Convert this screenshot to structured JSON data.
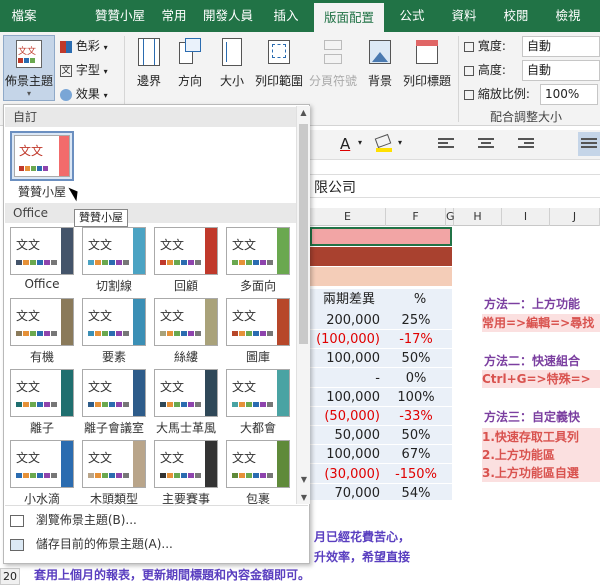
{
  "tabs": [
    "檔案",
    "贊贊小屋",
    "常用",
    "開發人員",
    "插入",
    "版面配置",
    "公式",
    "資料",
    "校閱",
    "檢視"
  ],
  "active_tab": "版面配置",
  "ribbon": {
    "theme_button": "佈景主題",
    "colors": "色彩",
    "fonts": "字型",
    "effects": "效果",
    "margins": "邊界",
    "orientation": "方向",
    "size": "大小",
    "print_area": "列印範圍",
    "breaks": "分頁符號",
    "background": "背景",
    "print_titles": "列印標題",
    "width_label": "寬度:",
    "width_value": "自動",
    "height_label": "高度:",
    "height_value": "自動",
    "scale_label": "縮放比例:",
    "scale_value": "100%",
    "group_label": "配合調整大小"
  },
  "gallery": {
    "custom_header": "自訂",
    "custom_theme_label": "贊贊小屋",
    "tooltip": "贊贊小屋",
    "office_header": "Office",
    "thumb_text": "文文",
    "themes": [
      {
        "label": "Office",
        "accent": "#44546a"
      },
      {
        "label": "切割線",
        "accent": "#4ba3c3"
      },
      {
        "label": "回顧",
        "accent": "#c0392b"
      },
      {
        "label": "多面向",
        "accent": "#6aa84f"
      },
      {
        "label": "有機",
        "accent": "#8a7a5a"
      },
      {
        "label": "要素",
        "accent": "#3b8fb5"
      },
      {
        "label": "絲縷",
        "accent": "#a9a27a"
      },
      {
        "label": "圖庫",
        "accent": "#b7472a"
      },
      {
        "label": "離子",
        "accent": "#1f6f6f"
      },
      {
        "label": "離子會議室",
        "accent": "#2e5c8a"
      },
      {
        "label": "大馬士革風",
        "accent": "#2f4858"
      },
      {
        "label": "大都會",
        "accent": "#4aa3a3"
      },
      {
        "label": "小水滴",
        "accent": "#2b6cb0"
      },
      {
        "label": "木頭類型",
        "accent": "#b9a58a"
      },
      {
        "label": "主要賽事",
        "accent": "#333333"
      },
      {
        "label": "包裹",
        "accent": "#5f8a3a"
      }
    ],
    "browse": "瀏覽佈景主題(B)...",
    "save": "儲存目前的佈景主題(A)..."
  },
  "formula_bar": {
    "text": "限公司"
  },
  "columns": [
    "E",
    "F",
    "G",
    "H",
    "I",
    "J"
  ],
  "table": {
    "header_e": "兩期差異",
    "header_f": "%",
    "rows": [
      {
        "e": "200,000",
        "f": "25%",
        "red": false
      },
      {
        "e": "(100,000)",
        "f": "-17%",
        "red": true
      },
      {
        "e": "100,000",
        "f": "50%",
        "red": false
      },
      {
        "e": "-",
        "f": "0%",
        "red": false
      },
      {
        "e": "100,000",
        "f": "100%",
        "red": false
      },
      {
        "e": "(50,000)",
        "f": "-33%",
        "red": true
      },
      {
        "e": "50,000",
        "f": "50%",
        "red": false
      },
      {
        "e": "100,000",
        "f": "67%",
        "red": false
      },
      {
        "e": "(30,000)",
        "f": "-150%",
        "red": true
      },
      {
        "e": "70,000",
        "f": "54%",
        "red": false
      }
    ]
  },
  "notes": {
    "m1_title": "方法一：上方功能",
    "m1_text": "常用=>編輯=>尋找",
    "m2_title": "方法二：快速組合",
    "m2_text": "Ctrl+G=>特殊=>",
    "m3_title": "方法三：自定義快",
    "m3_l1": "1.快速存取工具列",
    "m3_l2": "2.上方功能區",
    "m3_l3": "3.上方功能區自選",
    "bottom_l1": "月已經花費苦心，",
    "bottom_l2": "升效率，希望直接",
    "bottom_l3": "套用上個月的報表，更新期間標題和內容金額即可。"
  },
  "row_number": "20"
}
